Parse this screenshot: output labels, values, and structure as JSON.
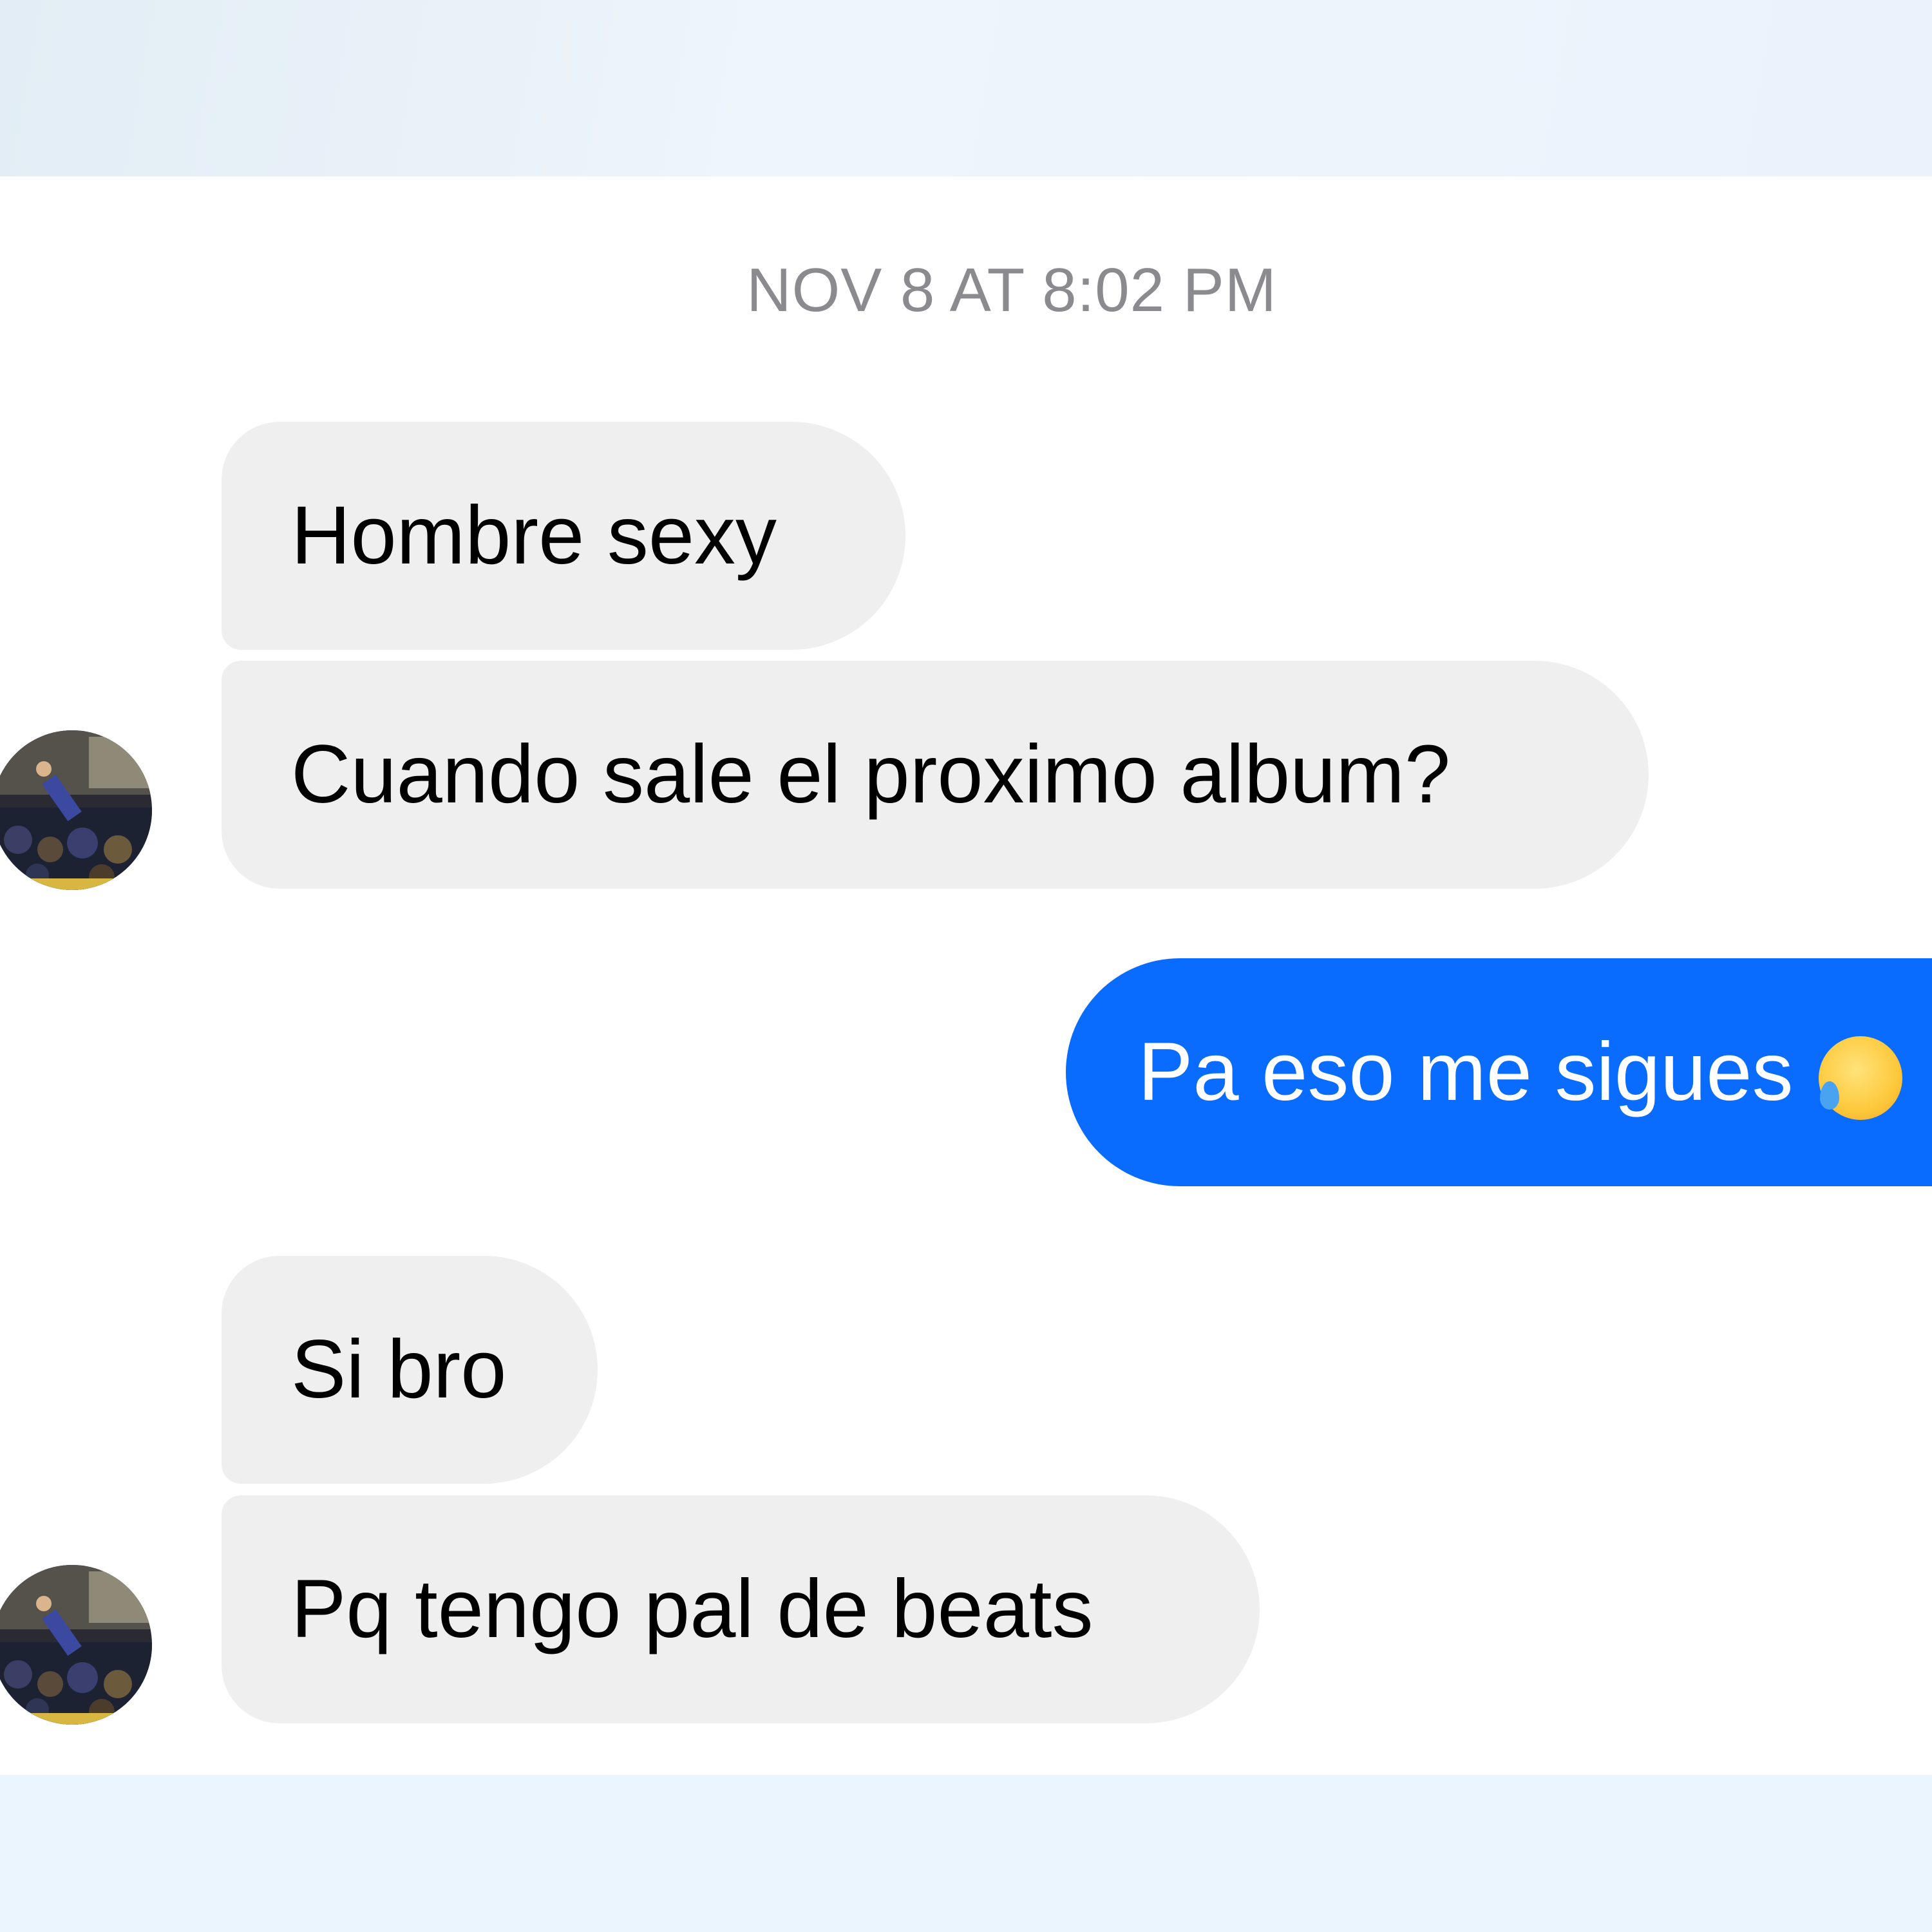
{
  "conversation": {
    "timestamp": "NOV 8 AT 8:02 PM",
    "messages": [
      {
        "sender": "other",
        "text": "Hombre sexy"
      },
      {
        "sender": "other",
        "text": "Cuando sale el proximo album?"
      },
      {
        "sender": "me",
        "text": "Pa eso me sigues",
        "emoji": "face-with-tears-of-joy-icon"
      },
      {
        "sender": "other",
        "text": "Si bro"
      },
      {
        "sender": "other",
        "text": "Pq tengo pal de beats"
      }
    ]
  },
  "colors": {
    "incoming_bubble": "#efefef",
    "outgoing_bubble": "#0a6cff",
    "timestamp_text": "#8a8a8f"
  }
}
